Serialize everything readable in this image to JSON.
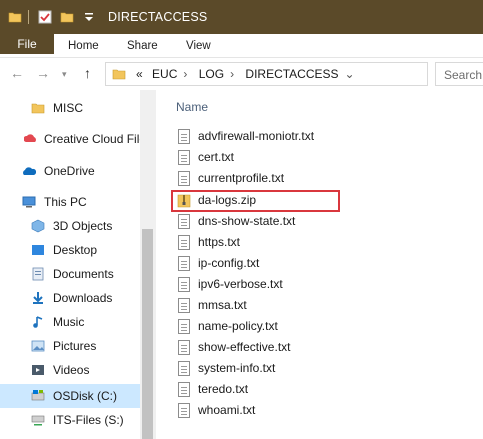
{
  "window": {
    "title": "DIRECTACCESS"
  },
  "ribbon": {
    "tabs": [
      "File",
      "Home",
      "Share",
      "View"
    ]
  },
  "address": {
    "crumbs": [
      "EUC",
      "LOG",
      "DIRECTACCESS"
    ],
    "overflow": "«",
    "search_placeholder": "Search"
  },
  "nav": {
    "items": [
      {
        "label": "MISC",
        "icon": "folder-icon"
      },
      {
        "label": "Creative Cloud Files",
        "icon": "creative-cloud-icon"
      },
      {
        "label": "OneDrive",
        "icon": "onedrive-icon"
      },
      {
        "label": "This PC",
        "icon": "this-pc-icon"
      },
      {
        "label": "3D Objects",
        "icon": "3d-objects-icon"
      },
      {
        "label": "Desktop",
        "icon": "desktop-icon"
      },
      {
        "label": "Documents",
        "icon": "documents-icon"
      },
      {
        "label": "Downloads",
        "icon": "downloads-icon"
      },
      {
        "label": "Music",
        "icon": "music-icon"
      },
      {
        "label": "Pictures",
        "icon": "pictures-icon"
      },
      {
        "label": "Videos",
        "icon": "videos-icon"
      },
      {
        "label": "OSDisk (C:)",
        "icon": "drive-icon"
      },
      {
        "label": "ITS-Files (S:)",
        "icon": "network-drive-icon"
      }
    ]
  },
  "list": {
    "column_name": "Name",
    "files": [
      "advfirewall-moniotr.txt",
      "cert.txt",
      "currentprofile.txt",
      "da-logs.zip",
      "dns-show-state.txt",
      "https.txt",
      "ip-config.txt",
      "ipv6-verbose.txt",
      "mmsa.txt",
      "name-policy.txt",
      "show-effective.txt",
      "system-info.txt",
      "teredo.txt",
      "whoami.txt"
    ]
  },
  "colors": {
    "accent": "#5b4a29",
    "highlight": "#d9373d",
    "selected": "#cce8ff"
  }
}
